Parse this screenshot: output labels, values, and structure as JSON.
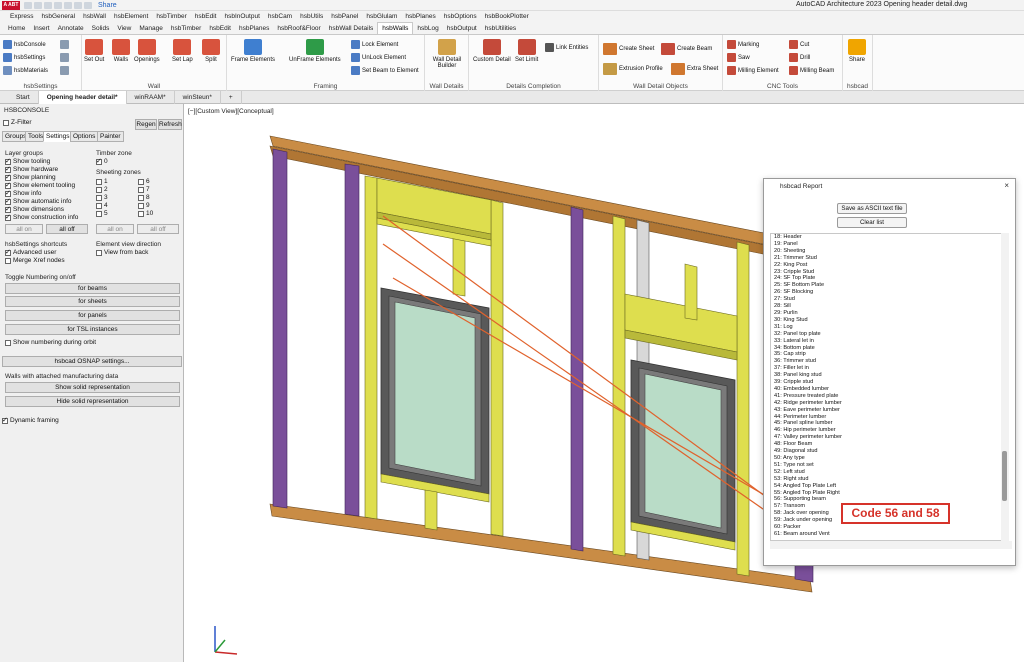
{
  "app": {
    "logo_text": "A ABT",
    "share_label": "Share",
    "window_title": "AutoCAD Architecture 2023    Opening header detail.dwg"
  },
  "menu": [
    "Express",
    "hsbGeneral",
    "hsbWall",
    "hsbElement",
    "hsbTimber",
    "hsbEdit",
    "hsbInOutput",
    "hsbCam",
    "hsbUtils",
    "hsbPanel",
    "hsbGlulam",
    "hsbPlanes",
    "hsbOptions",
    "hsbBookPlotter"
  ],
  "ribbon_tabs": [
    "Home",
    "Insert",
    "Annotate",
    "Solids",
    "View",
    "Manage",
    "hsbTimber",
    "hsbEdit",
    "hsbPlanes",
    "hsbRoof&Floor",
    "hsbWall Details",
    "hsbWalls",
    "hsbLog",
    "hsbOutput",
    "hsbUtilities"
  ],
  "active_ribbon_tab": "hsbWalls",
  "ribbon": {
    "hsbsettings": {
      "console": "hsbConsole",
      "settings": "hsbSettings",
      "materials": "hsbMaterials",
      "title": "hsbSettings"
    },
    "wall": {
      "set_out": "Set Out",
      "walls": "Walls",
      "openings": "Openings",
      "set_lap": "Set Lap",
      "split": "Split",
      "title": "Wall"
    },
    "framing": {
      "frame": "Frame Elements",
      "unframe": "UnFrame Elements",
      "lock": "Lock Element",
      "unlock": "UnLock Element",
      "set_beam": "Set Beam to Element",
      "title": "Framing"
    },
    "wall_details": {
      "builder": "Wall Detail Builder",
      "title": "Wall Details"
    },
    "details_completion": {
      "custom": "Custom Detail",
      "set_limit": "Set Limit",
      "link": "Link Entities",
      "title": "Details Completion"
    },
    "wall_detail_objects": {
      "create_sheet": "Create Sheet",
      "create_beam": "Create Beam",
      "extrusion": "Extrusion Profile",
      "extra_sheet": "Extra Sheet",
      "title": "Wall Detail Objects"
    },
    "cnc": {
      "marking": "Marking",
      "saw": "Saw",
      "milling_element": "Milling Element",
      "cut": "Cut",
      "drill": "Drill",
      "milling_beam": "Milling Beam",
      "title": "CNC Tools"
    },
    "hsbcad": {
      "share": "Share",
      "title": "hsbcad"
    }
  },
  "doc_tabs": [
    "Start",
    "Opening header detail*",
    "winRAAM*",
    "winSteun*"
  ],
  "console": {
    "header": "HSBCONSOLE",
    "zfilter": "Z-Filter",
    "regen": "Regen",
    "refresh": "Refresh",
    "tabs": [
      "Groups",
      "Tools",
      "Settings",
      "Options",
      "Painter"
    ],
    "layer_groups_title": "Layer groups",
    "layer_groups": [
      "Show tooling",
      "Show hardware",
      "Show planning",
      "Show element tooling",
      "Show info",
      "Show automatic info",
      "Show dimensions",
      "Show construction info"
    ],
    "timber_zone_title": "Timber zone",
    "timber_zone": "0",
    "sheeting_zones_title": "Sheeting zones",
    "sheeting_left": [
      "1",
      "2",
      "3",
      "4",
      "5"
    ],
    "sheeting_right": [
      "6",
      "7",
      "8",
      "9",
      "10"
    ],
    "all_on": "all on",
    "all_off": "all off",
    "shortcuts_title": "hsbSettings shortcuts",
    "advanced_user": "Advanced user",
    "merge_xref": "Merge Xref nodes",
    "element_view_title": "Element view direction",
    "view_from_back": "View from back",
    "toggle_title": "Toggle Numbering on/off",
    "for_beams": "for beams",
    "for_sheets": "for sheets",
    "for_panels": "for panels",
    "for_tsl": "for TSL instances",
    "show_numbering": "Show numbering during orbit",
    "osnap": "hsbcad OSNAP settings...",
    "walls_mfg_title": "Walls with attached manufacturing data",
    "show_solid": "Show solid representation",
    "hide_solid": "Hide solid representation",
    "dynamic_framing": "Dynamic framing"
  },
  "viewport": {
    "label": "[−][Custom View][Conceptual]"
  },
  "report": {
    "title": "hsbcad Report",
    "save_btn": "Save as ASCII text file",
    "clear_btn": "Clear list",
    "items": [
      "18: Header",
      "19: Panel",
      "20: Sheeting",
      "21: Trimmer Stud",
      "22: King Post",
      "23: Cripple Stud",
      "24: SF Top Plate",
      "25: SF Bottom Plate",
      "26: SF Blocking",
      "27: Stud",
      "28: Sill",
      "29: Purlin",
      "30: King Stud",
      "31: Log",
      "32: Panel top plate",
      "33: Lateral let in",
      "34: Bottom plate",
      "35: Cap strip",
      "36: Trimmer stud",
      "37: Filler let in",
      "38: Panel king stud",
      "39: Cripple stud",
      "40: Embedded lumber",
      "41: Pressure treated plate",
      "42: Ridge perimeter lumber",
      "43: Eave perimeter lumber",
      "44: Perimeter lumber",
      "45: Panel spline lumber",
      "46: Hip perimeter lumber",
      "47: Valley perimeter lumber",
      "48: Floor Beam",
      "49: Diagonal stud",
      "50: Any type",
      "51: Type not set",
      "52: Left stud",
      "53: Right stud",
      "54: Angled Top Plate Left",
      "55: Angled Top Plate Right",
      "56: Supporting beam",
      "57: Transom",
      "58: Jack over opening",
      "59: Jack under opening",
      "60: Packer",
      "61: Beam around Vent"
    ]
  },
  "annotation": {
    "text": "Code 56 and 58"
  },
  "colors": {
    "timber": "#c98c45",
    "header": "#dede4e",
    "purple": "#7a4f9a",
    "glass": "#b9dcc7",
    "frame": "#595959",
    "accent": "#d6332a"
  }
}
